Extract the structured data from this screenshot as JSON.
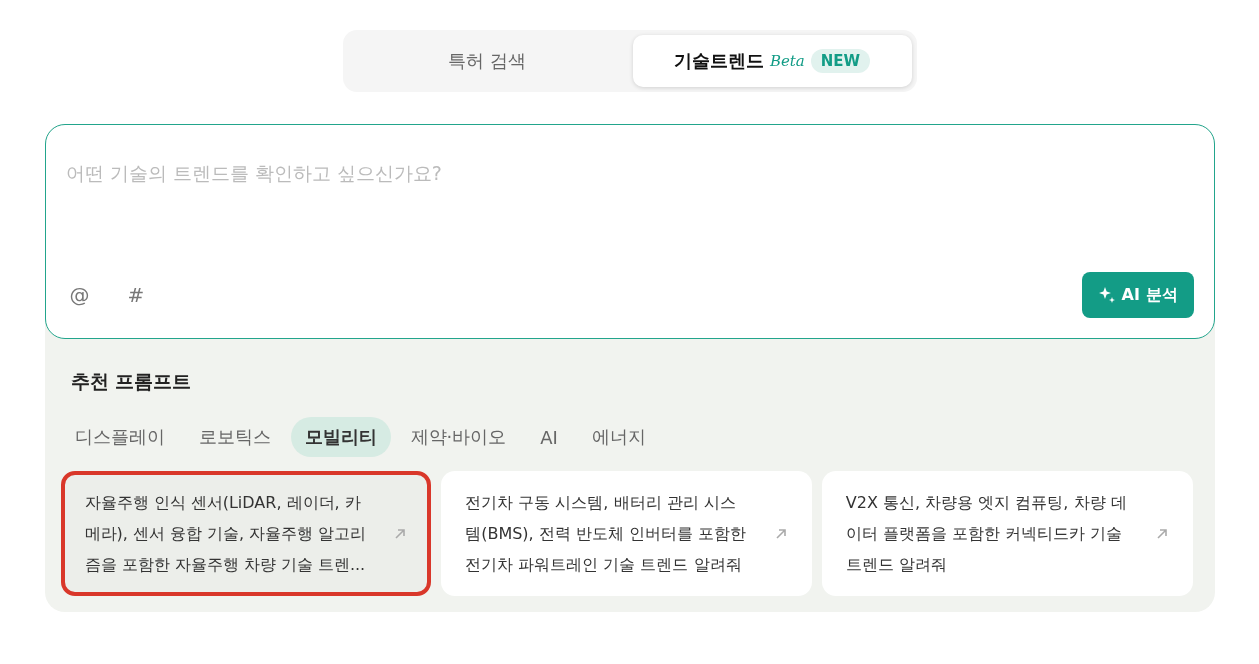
{
  "mode_tabs": [
    {
      "label": "특허 검색",
      "selected": false
    },
    {
      "label": "기술트렌드",
      "selected": true,
      "beta": "Beta",
      "badge": "NEW"
    }
  ],
  "prompt_box": {
    "placeholder": "어떤 기술의 트렌드를 확인하고 싶으신가요?",
    "mention_key": "@",
    "tag_key": "#",
    "submit_label": "AI 분석"
  },
  "recommend": {
    "title": "추천 프롬프트",
    "categories": [
      {
        "label": "디스플레이",
        "selected": false
      },
      {
        "label": "로보틱스",
        "selected": false
      },
      {
        "label": "모빌리티",
        "selected": true
      },
      {
        "label": "제약·바이오",
        "selected": false
      },
      {
        "label": "AI",
        "selected": false
      },
      {
        "label": "에너지",
        "selected": false
      }
    ],
    "cards": [
      {
        "lines": [
          "자율주행 인식 센서(LiDAR, 레이더, 카",
          "메라), 센서 융합 기술, 자율주행 알고리",
          "즘을 포함한 자율주행 차량 기술 트렌..."
        ],
        "highlighted": true
      },
      {
        "lines": [
          "전기차 구동 시스템, 배터리 관리 시스",
          "템(BMS), 전력 반도체 인버터를 포함한",
          "전기차 파워트레인 기술 트렌드 알려줘"
        ],
        "highlighted": false
      },
      {
        "lines": [
          "V2X 통신, 차량용 엣지 컴퓨팅, 차량 데",
          "이터 플랫폼을 포함한 커넥티드카 기술",
          "트렌드 알려줘"
        ],
        "highlighted": false
      }
    ]
  }
}
